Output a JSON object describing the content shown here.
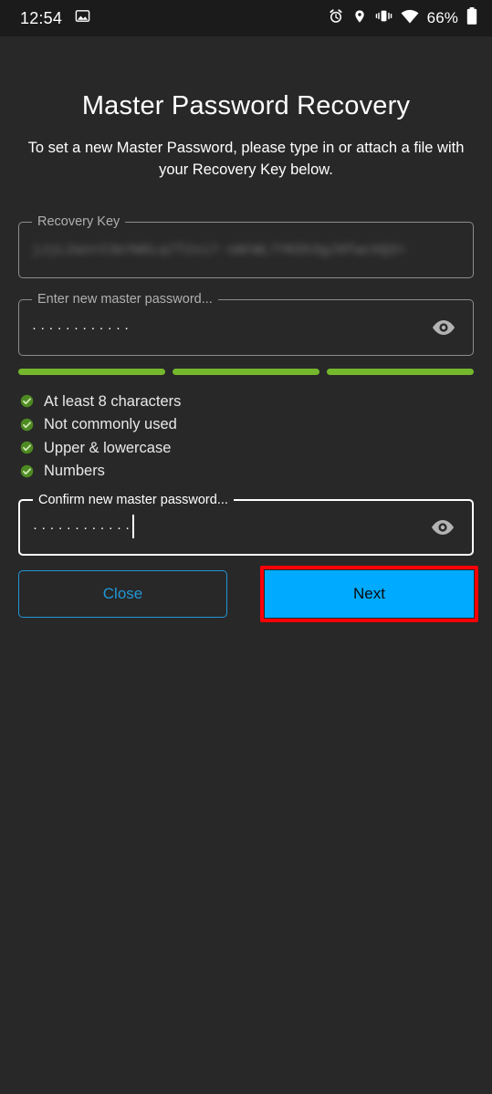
{
  "status_bar": {
    "time": "12:54",
    "left_icons": [
      {
        "name": "image-icon"
      }
    ],
    "right_icons": [
      {
        "name": "alarm-icon"
      },
      {
        "name": "location-pin-icon"
      },
      {
        "name": "vibrate-icon"
      },
      {
        "name": "wifi-icon"
      }
    ],
    "battery_percent": "66%",
    "battery_icon": "battery-icon"
  },
  "screen": {
    "title": "Master Password Recovery",
    "subtitle": "To set a new Master Password, please type in or attach a file with your Recovery Key below."
  },
  "fields": {
    "recovery_key": {
      "label": "Recovery Key",
      "value": "jJjL2anrC3eYW5Lq7T2xi7-xWtWL7YK5h3gJ9fwcXQ3=",
      "redacted": true,
      "focused": false
    },
    "new_password": {
      "label": "Enter new master password...",
      "value": "············",
      "masked_length": 12,
      "focused": false,
      "toggle_icon": "eye-icon"
    },
    "confirm_password": {
      "label": "Confirm new master password...",
      "value": "············",
      "masked_length": 12,
      "focused": true,
      "toggle_icon": "eye-icon"
    }
  },
  "strength_meter": {
    "segments": 3,
    "filled": 3,
    "color": "#76b82d"
  },
  "requirements": [
    {
      "label": "At least 8 characters",
      "met": true,
      "icon": "check-circle-icon"
    },
    {
      "label": "Not commonly used",
      "met": true,
      "icon": "check-circle-icon"
    },
    {
      "label": "Upper & lowercase",
      "met": true,
      "icon": "check-circle-icon"
    },
    {
      "label": "Numbers",
      "met": true,
      "icon": "check-circle-icon"
    }
  ],
  "buttons": {
    "close": {
      "label": "Close",
      "style": "outlined",
      "color": "#2196d6"
    },
    "next": {
      "label": "Next",
      "style": "filled",
      "color": "#00aaff",
      "highlight_color": "#fb0007"
    }
  },
  "colors": {
    "background": "#282828",
    "status_bar_background": "#1b1b1b",
    "accent": "#00aaff",
    "success": "#76b82d",
    "highlight": "#fb0007"
  }
}
